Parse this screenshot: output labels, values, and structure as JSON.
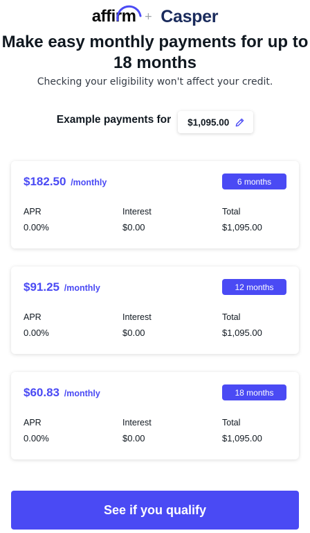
{
  "header": {
    "brand_affirm": "affirm",
    "plus": "+",
    "brand_casper": "Casper"
  },
  "title": "Make easy monthly payments for up to 18 months",
  "subtitle": "Checking your eligibility won't affect your credit.",
  "example": {
    "label": "Example payments for",
    "amount": "$1,095.00",
    "edit_icon": "pencil-icon"
  },
  "plans": [
    {
      "monthly": "$182.50",
      "per": "/monthly",
      "term": "6 months",
      "apr_label": "APR",
      "apr": "0.00%",
      "interest_label": "Interest",
      "interest": "$0.00",
      "total_label": "Total",
      "total": "$1,095.00"
    },
    {
      "monthly": "$91.25",
      "per": "/monthly",
      "term": "12 months",
      "apr_label": "APR",
      "apr": "0.00%",
      "interest_label": "Interest",
      "interest": "$0.00",
      "total_label": "Total",
      "total": "$1,095.00"
    },
    {
      "monthly": "$60.83",
      "per": "/monthly",
      "term": "18 months",
      "apr_label": "APR",
      "apr": "0.00%",
      "interest_label": "Interest",
      "interest": "$0.00",
      "total_label": "Total",
      "total": "$1,095.00"
    }
  ],
  "cta": {
    "label": "See if you qualify"
  },
  "colors": {
    "accent": "#4a4af4",
    "text": "#101820",
    "casper": "#1a2b5c"
  }
}
